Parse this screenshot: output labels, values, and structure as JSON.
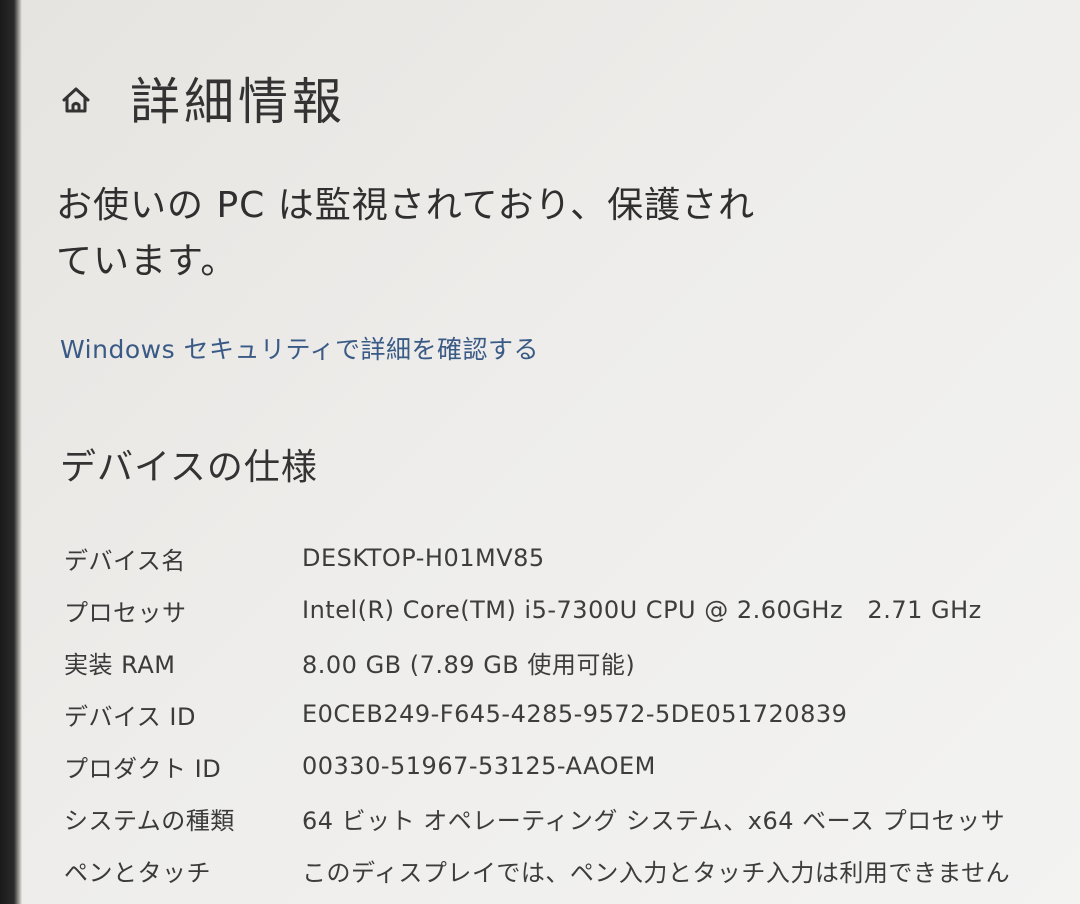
{
  "header": {
    "icon": "home-icon",
    "title": "詳細情報"
  },
  "protection": {
    "message_line1": "お使いの PC は監視されており、保護され",
    "message_line2": "ています。",
    "security_link": "Windows セキュリティで詳細を確認する"
  },
  "device_specs": {
    "title": "デバイスの仕様",
    "rows": [
      {
        "label": "デバイス名",
        "value": "DESKTOP-H01MV85"
      },
      {
        "label": "プロセッサ",
        "value": "Intel(R) Core(TM) i5-7300U CPU @ 2.60GHz   2.71 GHz"
      },
      {
        "label": "実装 RAM",
        "value": "8.00 GB (7.89 GB 使用可能)"
      },
      {
        "label": "デバイス ID",
        "value": "E0CEB249-F645-4285-9572-5DE051720839"
      },
      {
        "label": "プロダクト ID",
        "value": "00330-51967-53125-AAOEM"
      },
      {
        "label": "システムの種類",
        "value": "64 ビット オペレーティング システム、x64 ベース プロセッサ"
      },
      {
        "label": "ペンとタッチ",
        "value": "このディスプレイでは、ペン入力とタッチ入力は利用できません"
      }
    ]
  },
  "colors": {
    "link": "#3a5a86",
    "text": "#2e2e2e",
    "background": "#eeedeb"
  }
}
